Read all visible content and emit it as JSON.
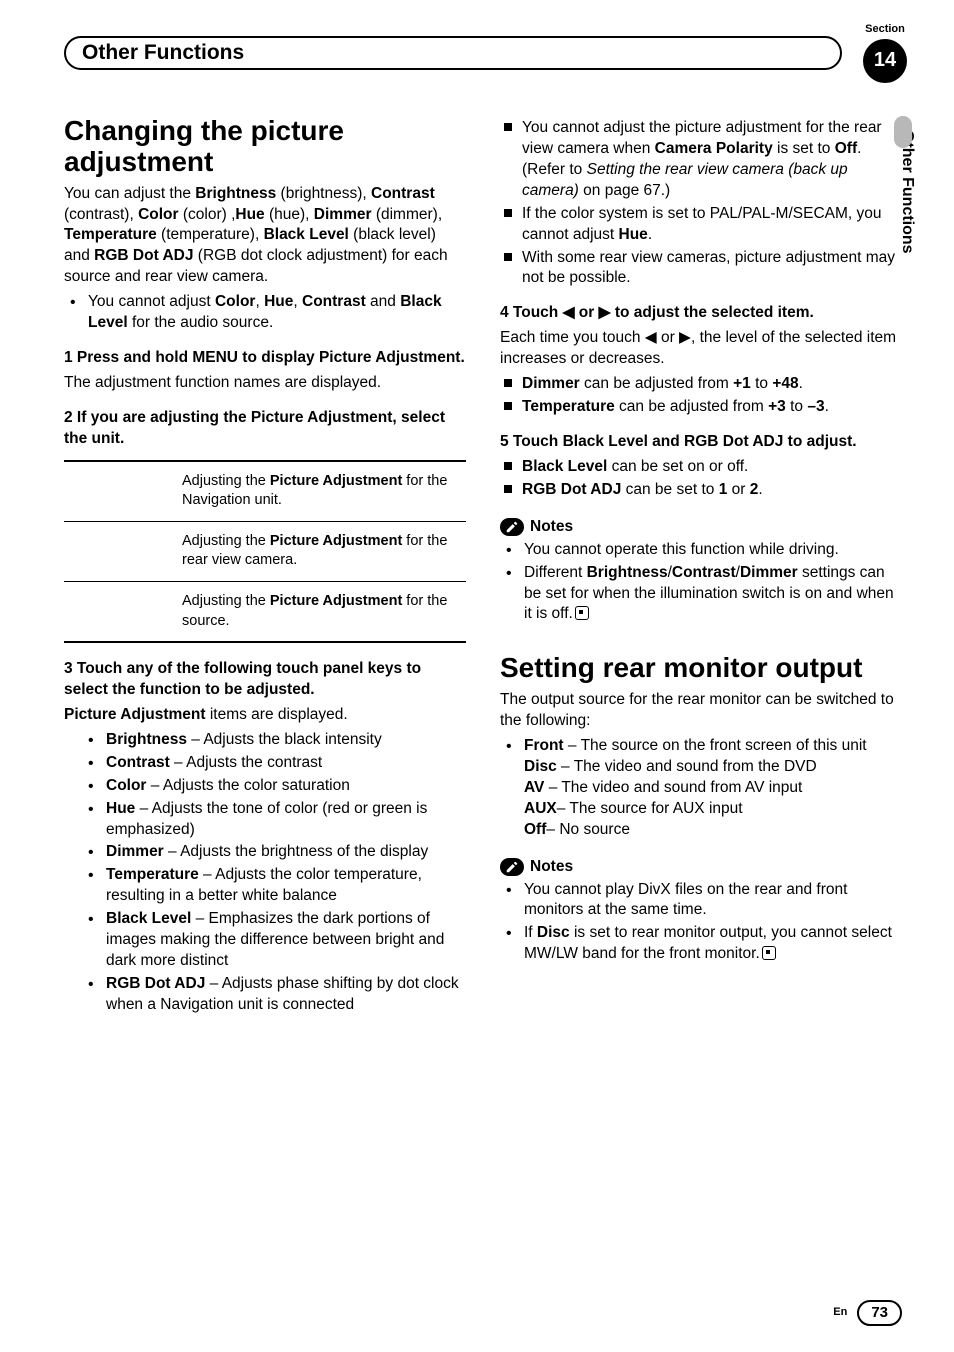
{
  "section": {
    "label": "Section",
    "number": "14"
  },
  "header": {
    "title": "Other Functions"
  },
  "side_tab": "Other Functions",
  "left": {
    "h1": "Changing the picture adjustment",
    "intro_parts": [
      "You can adjust the ",
      "Brightness",
      " (brightness), ",
      "Contrast",
      " (contrast), ",
      "Color",
      " (color) ,",
      "Hue",
      " (hue), ",
      "Dimmer",
      " (dimmer), ",
      "Temperature",
      " (temperature), ",
      "Black Level",
      " (black level) and ",
      "RGB Dot ADJ",
      " (RGB dot clock adjustment) for each source and rear view camera."
    ],
    "intro_bullet": {
      "pre": "You cannot adjust ",
      "b1": "Color",
      "sep1": ", ",
      "b2": "Hue",
      "sep2": ", ",
      "b3": "Contrast",
      "sep3": " and ",
      "b4": "Black Level",
      "post": " for the audio source."
    },
    "step1": "1    Press and hold MENU to display Picture Adjustment.",
    "step1_text": "The adjustment function names are displayed.",
    "step2": "2    If you are adjusting the Picture Adjustment, select the unit.",
    "table": [
      {
        "pre": "Adjusting the ",
        "bold": "Picture Adjustment",
        "post": " for the Navigation unit."
      },
      {
        "pre": "Adjusting the ",
        "bold": "Picture Adjustment",
        "post": " for the rear view camera."
      },
      {
        "pre": "Adjusting the ",
        "bold": "Picture Adjustment",
        "post": " for the source."
      }
    ],
    "step3": "3    Touch any of the following touch panel keys to select the function to be adjusted.",
    "step3_lead": {
      "bold": "Picture Adjustment",
      "rest": " items are displayed."
    },
    "items": [
      {
        "name": "Brightness",
        "desc": " – Adjusts the black intensity"
      },
      {
        "name": "Contrast",
        "desc": " – Adjusts the contrast"
      },
      {
        "name": "Color",
        "desc": " – Adjusts the color saturation"
      },
      {
        "name": "Hue",
        "desc": " – Adjusts the tone of color (red or green is emphasized)"
      },
      {
        "name": "Dimmer",
        "desc": " – Adjusts the brightness of the display"
      },
      {
        "name": "Temperature",
        "desc": " – Adjusts the color temperature, resulting in a better white balance"
      },
      {
        "name": "Black Level",
        "desc": " – Emphasizes the dark portions of images making the difference between bright and dark more distinct"
      },
      {
        "name": "RGB Dot ADJ",
        "desc": " – Adjusts phase shifting by dot clock when a Navigation unit is connected"
      }
    ]
  },
  "right": {
    "sq1": {
      "text1": "You cannot adjust the picture adjustment for the rear view camera when ",
      "b1": "Camera Polarity",
      "text2": " is set to ",
      "b2": "Off",
      "text3": ". (Refer to ",
      "ital": "Setting the rear view camera (back up camera)",
      "text4": " on page 67.)"
    },
    "sq2": {
      "text1": "If the color system is set to PAL/PAL-M/SECAM, you cannot adjust ",
      "b1": "Hue",
      "text2": "."
    },
    "sq3": "With some rear view cameras, picture adjustment may not be possible.",
    "step4": "4    Touch ◀ or ▶ to adjust the selected item.",
    "step4_text": "Each time you touch ◀ or ▶, the level of the selected item increases or decreases.",
    "step4_items": [
      {
        "b1": "Dimmer",
        "mid": " can be adjusted from ",
        "b2": "+1",
        "mid2": " to ",
        "b3": "+48",
        "end": "."
      },
      {
        "b1": "Temperature",
        "mid": " can be adjusted from ",
        "b2": "+3",
        "mid2": " to ",
        "b3": "–3",
        "end": "."
      }
    ],
    "step5": "5    Touch Black Level and RGB Dot ADJ to adjust.",
    "step5_items": [
      {
        "b1": "Black Level",
        "rest": " can be set on or off."
      },
      {
        "b1": "RGB Dot ADJ",
        "mid": " can be set to ",
        "b2": "1",
        "mid2": " or ",
        "b3": "2",
        "end": "."
      }
    ],
    "notes_label": "Notes",
    "notes1": [
      "You cannot operate this function while driving."
    ],
    "notes1b": {
      "pre": "Different ",
      "b1": "Brightness",
      "s1": "/",
      "b2": "Contrast",
      "s2": "/",
      "b3": "Dimmer",
      "post": " settings can be set for when the illumination switch is on and when it is off."
    },
    "h2": "Setting rear monitor output",
    "h2_intro": "The output source for the rear monitor can be switched to the following:",
    "front_item": {
      "b": "Front",
      "rest": " – The source on the front screen of this unit"
    },
    "sub": [
      {
        "b": "Disc",
        "rest": " – The video and sound from the DVD"
      },
      {
        "b": "AV",
        "rest": " – The video and sound from AV input"
      },
      {
        "b": "AUX",
        "rest": "– The source for AUX input"
      },
      {
        "b": "Off",
        "rest": "– No source"
      }
    ],
    "notes2": [
      "You cannot play DivX files on the rear and front monitors at the same time."
    ],
    "notes2b": {
      "pre": "If ",
      "b": "Disc",
      "post": " is set to rear monitor output, you cannot select MW/LW band for the front monitor."
    }
  },
  "footer": {
    "en": "En",
    "page": "73"
  }
}
